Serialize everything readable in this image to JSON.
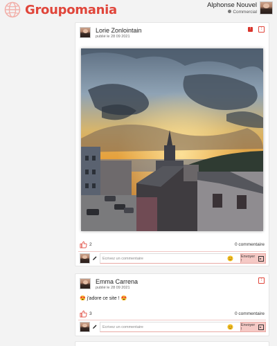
{
  "header": {
    "logo_text": "Groupomania",
    "user_name": "Alphonse Nouvel",
    "user_role": "Commercial"
  },
  "posts": [
    {
      "author": "Lorie Zonlointain",
      "date": "publié le 28 09 2021",
      "text": "",
      "likes": "2",
      "comments": "0 commentaire",
      "comment_placeholder": "Ecrivez un commentaire",
      "send_label": "Envoyer !",
      "has_flag": true
    },
    {
      "author": "Emma Carrena",
      "date": "publié le 28 09 2021",
      "text": "😍 j'adore ce site ! 😍",
      "likes": "3",
      "comments": "0 commentaire",
      "comment_placeholder": "Ecrivez un commentaire",
      "send_label": "Envoyer !",
      "has_flag": false
    }
  ],
  "colors": {
    "brand": "#e0453a",
    "send_bg": "#f5c9c5",
    "background": "#f3f3f3"
  },
  "icons": [
    "globe-logo-icon",
    "flag-icon",
    "menu-icon",
    "like-icon",
    "pencil-icon",
    "emoji-icon",
    "send-icon"
  ]
}
